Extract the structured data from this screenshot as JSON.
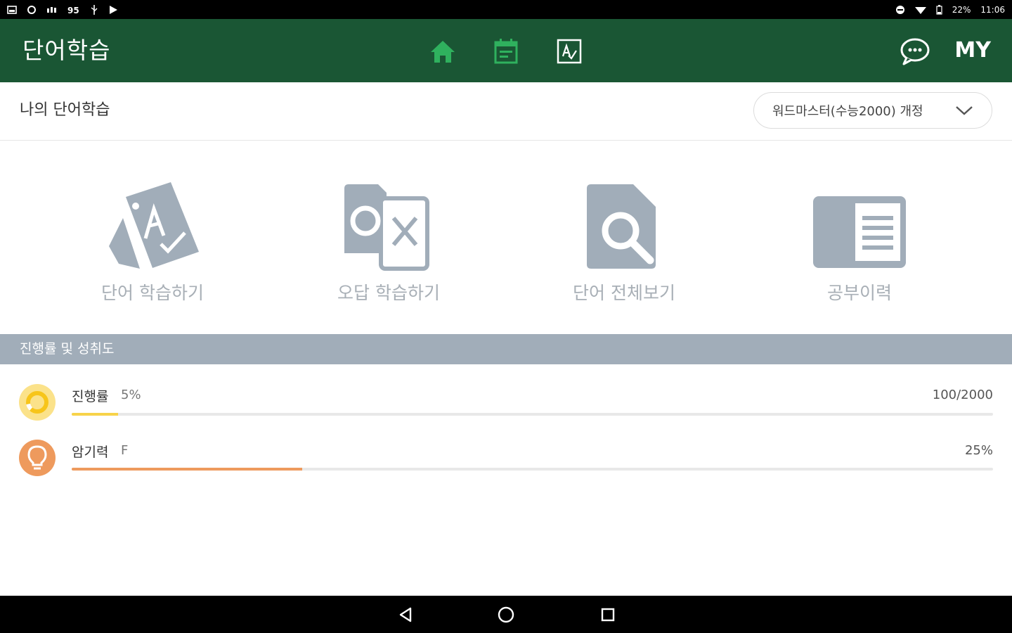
{
  "status_bar": {
    "left_icons": [
      "image-icon",
      "sync-icon",
      "signal-bars-icon",
      "badge-icon",
      "usb-icon",
      "play-store-icon"
    ],
    "battery": "22%",
    "time": "11:06"
  },
  "app_bar": {
    "title": "단어학습",
    "nav": [
      "home-icon",
      "calendar-icon",
      "test-icon"
    ],
    "chat_icon": "chat-bubble-icon",
    "my_label": "MY",
    "active_color": "#2fb15e",
    "background": "#1a5634"
  },
  "sub_header": {
    "title": "나의 단어학습",
    "book_select": "워드마스터(수능2000) 개정"
  },
  "menu": [
    {
      "label": "단어 학습하기",
      "icon": "word-cards-icon"
    },
    {
      "label": "오답 학습하기",
      "icon": "wrong-answer-icon"
    },
    {
      "label": "단어 전체보기",
      "icon": "document-search-icon"
    },
    {
      "label": "공부이력",
      "icon": "study-history-icon"
    }
  ],
  "progress_section": {
    "title": "진행률 및 성취도",
    "rows": [
      {
        "label": "진행률",
        "value": "5%",
        "right": "100/2000",
        "fill": 0.05,
        "color": "#f7d34a",
        "icon_bg": "#fbe28a",
        "icon": "progress-ring-icon"
      },
      {
        "label": "암기력",
        "value": "F",
        "right": "25%",
        "fill": 0.25,
        "color": "#ee9a5d",
        "icon_bg": "#ee9a5d",
        "icon": "lightbulb-icon"
      }
    ]
  },
  "nav_bar": {
    "buttons": [
      "back-icon",
      "home-circle-icon",
      "recents-icon"
    ]
  }
}
